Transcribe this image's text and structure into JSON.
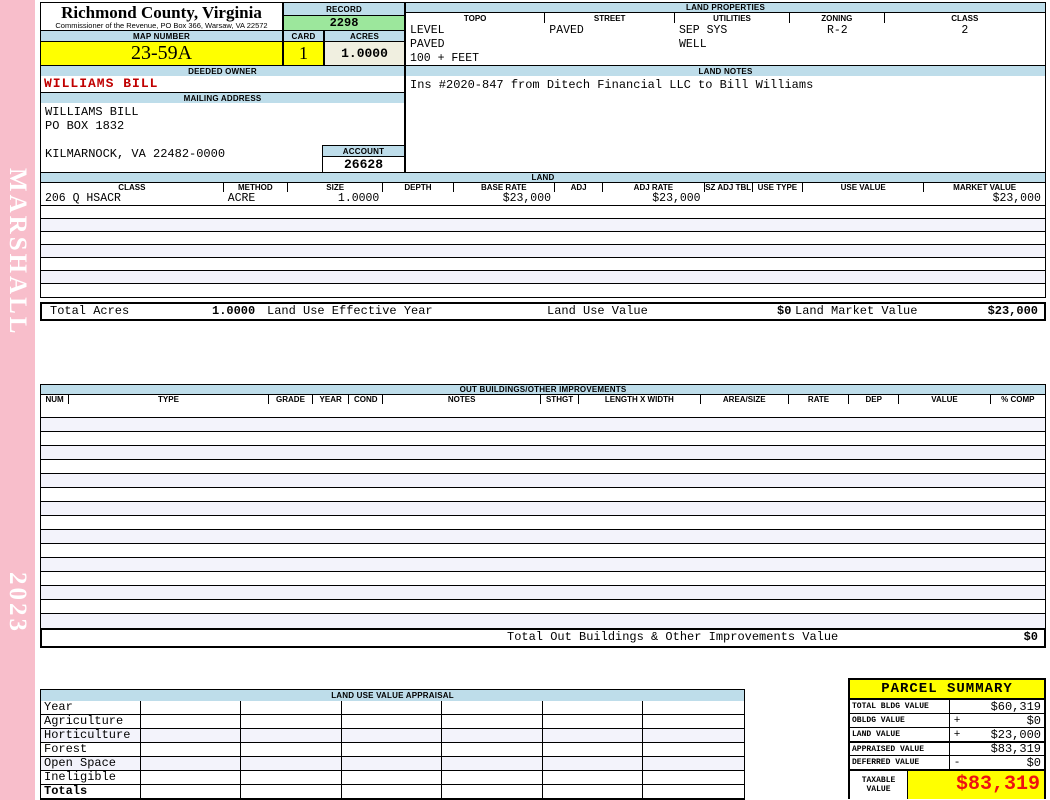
{
  "colors": {
    "header_blue": "#BEDDEA",
    "record_green": "#9CE79C",
    "highlight_yellow": "#FFFF00",
    "acres_beige": "#F0EFE0",
    "sidebar_pink": "#F8BECB",
    "owner_red": "#C00000",
    "taxable_red": "#EE1111"
  },
  "sidebar": {
    "vendor": "MARSHALL",
    "year": "2023"
  },
  "header": {
    "county_title": "Richmond County, Virginia",
    "county_subtitle": "Commissioner of the Revenue, PO Box 366, Warsaw, VA 22572",
    "record_label": "RECORD",
    "record_value": "2298",
    "map_number_label": "MAP NUMBER",
    "map_number_value": "23-59A",
    "card_label": "CARD",
    "card_value": "1",
    "acres_label": "ACRES",
    "acres_value": "1.0000"
  },
  "owner": {
    "deeded_owner_label": "DEEDED OWNER",
    "deeded_owner": "WILLIAMS BILL",
    "mailing_address_label": "MAILING ADDRESS",
    "address_lines": [
      "WILLIAMS BILL",
      "PO BOX 1832",
      "",
      "KILMARNOCK, VA 22482-0000"
    ],
    "account_label": "ACCOUNT",
    "account_value": "26628"
  },
  "land_properties": {
    "title": "LAND PROPERTIES",
    "columns": [
      "TOPO",
      "STREET",
      "UTILITIES",
      "ZONING",
      "CLASS"
    ],
    "rows": [
      [
        "LEVEL",
        "PAVED",
        "SEP SYS",
        "R-2",
        "2"
      ],
      [
        "PAVED",
        "",
        "WELL",
        "",
        ""
      ],
      [
        "100 + FEET",
        "",
        "",
        "",
        ""
      ]
    ]
  },
  "land_notes": {
    "title": "LAND NOTES",
    "text": "Ins #2020-847 from Ditech Financial LLC to Bill Williams"
  },
  "land": {
    "title": "LAND",
    "columns": [
      "CLASS",
      "METHOD",
      "SIZE",
      "DEPTH",
      "BASE RATE",
      "ADJ",
      "ADJ RATE",
      "SZ ADJ TBL",
      "USE TYPE",
      "USE VALUE",
      "MARKET VALUE"
    ],
    "rows": [
      [
        "206 Q HSACR",
        "ACRE",
        "1.0000",
        "",
        "$23,000",
        "",
        "$23,000",
        "",
        "",
        "",
        "$23,000"
      ]
    ],
    "empty_row_count": 7,
    "totals": {
      "total_acres_label": "Total Acres",
      "total_acres_value": "1.0000",
      "effective_year_label": "Land Use Effective Year",
      "use_value_label": "Land Use Value",
      "use_value": "$0",
      "market_value_label": "Land Market Value",
      "market_value": "$23,000"
    }
  },
  "out_buildings": {
    "title": "OUT BUILDINGS/OTHER IMPROVEMENTS",
    "columns": [
      "NUM",
      "TYPE",
      "GRADE",
      "YEAR",
      "COND",
      "NOTES",
      "STHGT",
      "LENGTH X WIDTH",
      "AREA/SIZE",
      "RATE",
      "DEP",
      "VALUE",
      "% COMP"
    ],
    "empty_row_count": 16,
    "total_label": "Total Out Buildings & Other Improvements Value",
    "total_value": "$0"
  },
  "land_use_appraisal": {
    "title": "LAND USE VALUE APPRAISAL",
    "row_labels": [
      "Year",
      "Agriculture",
      "Horticulture",
      "Forest",
      "Open Space",
      "Ineligible",
      "Totals"
    ],
    "column_count": 6
  },
  "parcel_summary": {
    "title": "PARCEL SUMMARY",
    "rows": [
      {
        "label": "TOTAL BLDG VALUE",
        "op": "",
        "value": "$60,319"
      },
      {
        "label": "OBLDG VALUE",
        "op": "+",
        "value": "$0"
      },
      {
        "label": "LAND VALUE",
        "op": "+",
        "value": "$23,000"
      },
      {
        "label": "APPRAISED VALUE",
        "op": "",
        "value": "$83,319"
      },
      {
        "label": "DEFERRED VALUE",
        "op": "-",
        "value": "$0"
      }
    ],
    "taxable_label": "TAXABLE VALUE",
    "taxable_value": "$83,319"
  }
}
